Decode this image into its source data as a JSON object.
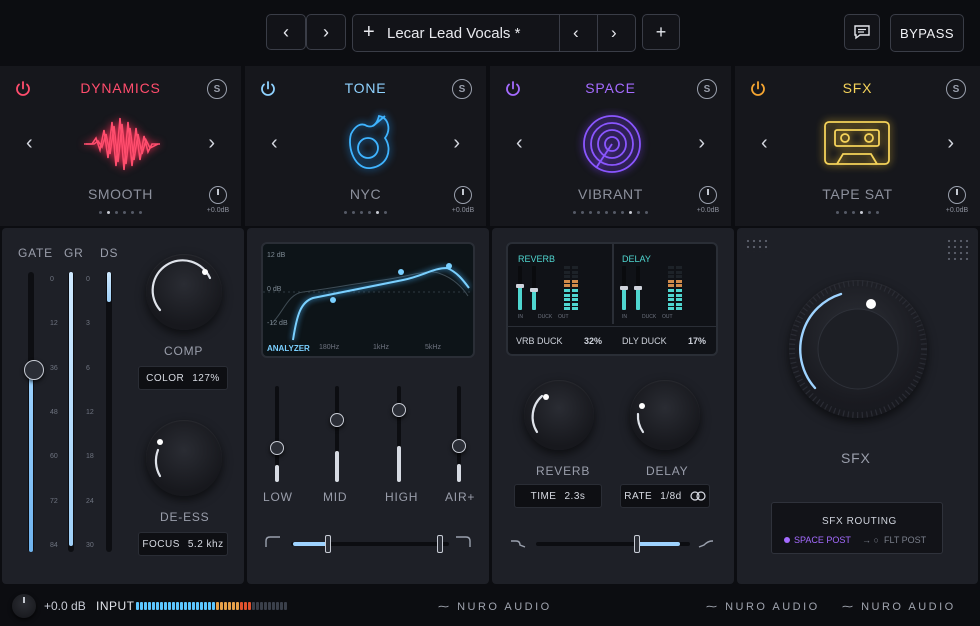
{
  "toolbar": {
    "preset_name": "Lecar Lead Vocals *",
    "bypass_label": "BYPASS",
    "add_glyph": "+",
    "prev_glyph": "‹",
    "next_glyph": "›"
  },
  "modules": [
    {
      "title": "DYNAMICS",
      "preset": "SMOOTH",
      "gain": "+0.0dB",
      "solo": "S",
      "color": "#ff4d6d",
      "power_color": "#ff4d6d"
    },
    {
      "title": "TONE",
      "preset": "NYC",
      "gain": "+0.0dB",
      "solo": "S",
      "color": "#8fd2ff",
      "power_color": "#8fd2ff"
    },
    {
      "title": "SPACE",
      "preset": "VIBRANT",
      "gain": "+0.0dB",
      "solo": "S",
      "color": "#a46bff",
      "power_color": "#a46bff"
    },
    {
      "title": "SFX",
      "preset": "TAPE SAT",
      "gain": "+0.0dB",
      "solo": "S",
      "color": "#f5d35a",
      "power_color": "#f5a531"
    }
  ],
  "dynamics": {
    "meter_labels": [
      "GATE",
      "GR",
      "DS"
    ],
    "scale": [
      "0",
      "12",
      "36",
      "48",
      "60",
      "72",
      "84"
    ],
    "scale2": [
      "0",
      "3",
      "6",
      "12",
      "18",
      "24",
      "30"
    ],
    "gate_level": 0.65,
    "gr_level": 0.98,
    "ds_level": 0.93,
    "comp_label": "COMP",
    "color_label": "COLOR",
    "color_value": "127%",
    "deess_label": "DE-ESS",
    "focus_label": "FOCUS",
    "focus_value": "5.2 khz"
  },
  "tone": {
    "analyzer_label": "ANALYZER",
    "db_labels": [
      "12 dB",
      "0 dB",
      "-12 dB"
    ],
    "freq_labels": [
      "180Hz",
      "1kHz",
      "5kHz"
    ],
    "bands": [
      {
        "label": "LOW",
        "level": 0.35
      },
      {
        "label": "MID",
        "level": 0.65
      },
      {
        "label": "HIGH",
        "level": 0.75
      },
      {
        "label": "AIR+",
        "level": 0.37
      }
    ]
  },
  "space": {
    "reverb_label": "REVERB",
    "delay_label": "DELAY",
    "vrb_duck_label": "VRB DUCK",
    "vrb_duck_value": "32%",
    "dly_duck_label": "DLY DUCK",
    "dly_duck_value": "17%",
    "meter_sub_labels": [
      "IN",
      "DUCK",
      "OUT"
    ],
    "knob_reverb_label": "REVERB",
    "knob_delay_label": "DELAY",
    "time_label": "TIME",
    "time_value": "2.3s",
    "rate_label": "RATE",
    "rate_value": "1/8d"
  },
  "sfx": {
    "knob_label": "SFX",
    "routing_title": "SFX ROUTING",
    "routing_option_1": "SPACE POST",
    "routing_option_2": "FLT POST",
    "routing_selected_color": "#a46bff"
  },
  "footer": {
    "input_gain": "+0.0 dB",
    "input_label": "INPUT",
    "brands": [
      "NURO AUDIO",
      "NURO AUDIO",
      "NURO AUDIO"
    ]
  }
}
